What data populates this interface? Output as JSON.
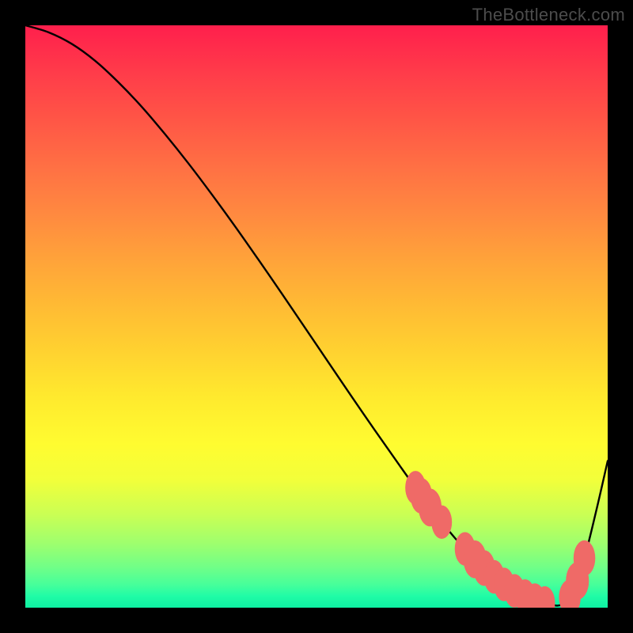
{
  "attribution": "TheBottleneck.com",
  "chart_data": {
    "type": "line",
    "title": "",
    "xlabel": "",
    "ylabel": "",
    "xlim": [
      0,
      100
    ],
    "ylim": [
      0,
      100
    ],
    "series": [
      {
        "name": "bottleneck-curve",
        "x": [
          0,
          4,
          8,
          12,
          16,
          20,
          24,
          28,
          32,
          36,
          40,
          44,
          48,
          52,
          56,
          60,
          64,
          67,
          70,
          72,
          74,
          76,
          78,
          80,
          82,
          84,
          86,
          88,
          90,
          92,
          94,
          96,
          98,
          100
        ],
        "y": [
          100,
          98.8,
          96.8,
          93.9,
          90.2,
          86,
          81.3,
          76.3,
          71,
          65.5,
          59.8,
          54,
          48.1,
          42.2,
          36.3,
          30.5,
          24.8,
          20.6,
          16.6,
          14.1,
          11.7,
          9.5,
          7.5,
          5.7,
          4.1,
          2.8,
          1.8,
          1.1,
          0.6,
          0.5,
          2.5,
          8.5,
          16.5,
          25.2
        ]
      }
    ],
    "markers": {
      "name": "highlight-dots",
      "color": "#ef6a67",
      "points": [
        {
          "x": 67,
          "y": 20.6,
          "r": 3.2
        },
        {
          "x": 68,
          "y": 19.2,
          "r": 3.4
        },
        {
          "x": 69.5,
          "y": 17.2,
          "r": 3.6
        },
        {
          "x": 71.5,
          "y": 14.7,
          "r": 3.2
        },
        {
          "x": 75.5,
          "y": 10.1,
          "r": 3.2
        },
        {
          "x": 77.2,
          "y": 8.3,
          "r": 3.6
        },
        {
          "x": 78.8,
          "y": 6.8,
          "r": 3.4
        },
        {
          "x": 80.5,
          "y": 5.3,
          "r": 3.2
        },
        {
          "x": 82.2,
          "y": 4.0,
          "r": 3.2
        },
        {
          "x": 84.0,
          "y": 2.9,
          "r": 3.2
        },
        {
          "x": 85.8,
          "y": 2.0,
          "r": 3.2
        },
        {
          "x": 87.5,
          "y": 1.3,
          "r": 3.2
        },
        {
          "x": 89.2,
          "y": 0.8,
          "r": 3.2
        },
        {
          "x": 93.5,
          "y": 1.8,
          "r": 3.4
        },
        {
          "x": 94.8,
          "y": 4.6,
          "r": 3.6
        },
        {
          "x": 96.0,
          "y": 8.5,
          "r": 3.4
        }
      ]
    },
    "gradient_stops": [
      {
        "pos": 0,
        "color": "#ff1f4c"
      },
      {
        "pos": 8,
        "color": "#ff3b4a"
      },
      {
        "pos": 16,
        "color": "#ff5546"
      },
      {
        "pos": 24,
        "color": "#ff6f44"
      },
      {
        "pos": 32,
        "color": "#ff8840"
      },
      {
        "pos": 40,
        "color": "#ffa23a"
      },
      {
        "pos": 48,
        "color": "#ffba34"
      },
      {
        "pos": 56,
        "color": "#ffd230"
      },
      {
        "pos": 64,
        "color": "#ffea2e"
      },
      {
        "pos": 72,
        "color": "#fffc30"
      },
      {
        "pos": 78,
        "color": "#f2ff3a"
      },
      {
        "pos": 84,
        "color": "#caff54"
      },
      {
        "pos": 89,
        "color": "#9eff6e"
      },
      {
        "pos": 93,
        "color": "#71ff87"
      },
      {
        "pos": 96,
        "color": "#47ff9a"
      },
      {
        "pos": 98,
        "color": "#20fca6"
      },
      {
        "pos": 100,
        "color": "#0ef0a2"
      }
    ]
  }
}
